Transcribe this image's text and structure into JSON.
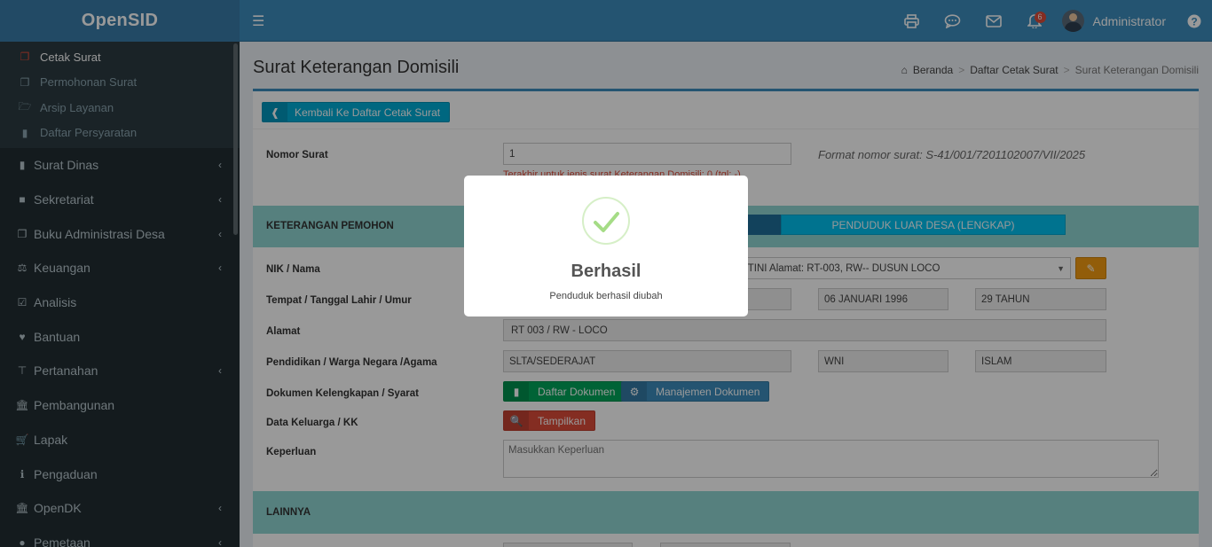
{
  "header": {
    "logo": "OpenSID",
    "notif_count": "6",
    "user_name": "Administrator"
  },
  "sidebar": {
    "submenu": [
      {
        "label": "Cetak Surat",
        "icon": "copy-icon"
      },
      {
        "label": "Permohonan Surat",
        "icon": "copy-icon"
      },
      {
        "label": "Arsip Layanan",
        "icon": "folder-open-icon"
      },
      {
        "label": "Daftar Persyaratan",
        "icon": "book-icon"
      }
    ],
    "items": [
      {
        "label": "Surat Dinas",
        "icon": "book-icon"
      },
      {
        "label": "Sekretariat",
        "icon": "archive-icon"
      },
      {
        "label": "Buku Administrasi Desa",
        "icon": "files-icon"
      },
      {
        "label": "Keuangan",
        "icon": "balance-scale-icon"
      },
      {
        "label": "Analisis",
        "icon": "check-square-icon"
      },
      {
        "label": "Bantuan",
        "icon": "heart-icon"
      },
      {
        "label": "Pertanahan",
        "icon": "signpost-icon"
      },
      {
        "label": "Pembangunan",
        "icon": "institution-icon"
      },
      {
        "label": "Lapak",
        "icon": "cart-icon"
      },
      {
        "label": "Pengaduan",
        "icon": "info-icon"
      },
      {
        "label": "OpenDK",
        "icon": "institution-icon"
      },
      {
        "label": "Pemetaan",
        "icon": "globe-icon"
      }
    ]
  },
  "page": {
    "title": "Surat Keterangan Domisili",
    "breadcrumb": [
      "Beranda",
      "Daftar Cetak Surat",
      "Surat Keterangan Domisili"
    ]
  },
  "form": {
    "back_button": "Kembali Ke Daftar Cetak Surat",
    "nomor_label": "Nomor Surat",
    "nomor_value": "1",
    "nomor_format": "Format nomor surat: S-41/001/7201102007/VII/2025",
    "nomor_last": "Terakhir untuk jenis surat Keterangan Domisili: 0 (tgl: -)",
    "section_pemohon": "KETERANGAN PEMOHON",
    "tab_luar": "PENDUDUK LUAR DESA (LENGKAP)",
    "nik_label": "NIK / Nama",
    "nik_value": "ARTINI Alamat: RT-003, RW-- DUSUN LOCO",
    "ttl_label": "Tempat / Tanggal Lahir / Umur",
    "tgl_lahir": "06 JANUARI 1996",
    "umur": "29 TAHUN",
    "alamat_label": "Alamat",
    "alamat_value": "RT 003 / RW -  LOCO",
    "pendidikan_label": "Pendidikan / Warga Negara /Agama",
    "pendidikan": "SLTA/SEDERAJAT",
    "warga_negara": "WNI",
    "agama": "ISLAM",
    "dokumen_label": "Dokumen Kelengkapan / Syarat",
    "daftar_dokumen": "Daftar Dokumen",
    "manajemen_dokumen": "Manajemen Dokumen",
    "kk_label": "Data Keluarga / KK",
    "tampilkan": "Tampilkan",
    "keperluan_label": "Keperluan",
    "keperluan_placeholder": "Masukkan Keperluan",
    "section_lainnya": "LAINNYA"
  },
  "modal": {
    "title": "Berhasil",
    "message": "Penduduk berhasil diubah"
  },
  "colors": {
    "header": "#3c8dbc",
    "sidebar": "#222d32",
    "section": "#8fd6d3",
    "success_check": "#a5dc86"
  }
}
